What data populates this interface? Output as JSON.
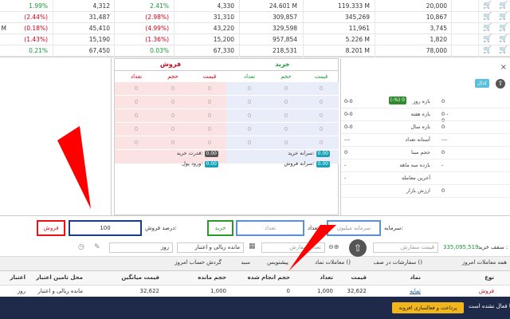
{
  "market": {
    "rows": [
      {
        "c1": "1.99%",
        "c2": "4,312",
        "c3": "2.41%",
        "c4": "4,330",
        "c5": "24.601 M",
        "c6": "119.333 M",
        "c7": "20,000",
        "t1": "pos",
        "t3": "pos"
      },
      {
        "c1": "(2.44%)",
        "c2": "31,487",
        "c3": "(2.98%)",
        "c4": "31,310",
        "c5": "309,857",
        "c6": "345,269",
        "c7": "10,867",
        "t1": "neg",
        "t3": "neg"
      },
      {
        "c1": "(0.18%)",
        "c2": "45,410",
        "c3": "(4.99%)",
        "c4": "43,220",
        "c5": "329,598",
        "c6": "11,961",
        "c7": "3,745",
        "t1": "neg",
        "t3": "neg",
        "lead": "M"
      },
      {
        "c1": "(1.43%)",
        "c2": "15,190",
        "c3": "(1.36%)",
        "c4": "15,200",
        "c5": "957,854",
        "c6": "5.226 M",
        "c7": "1,820",
        "t1": "neg",
        "t3": "neg"
      },
      {
        "c1": "0.21%",
        "c2": "67,450",
        "c3": "0.03%",
        "c4": "67,330",
        "c5": "218,531",
        "c6": "8.201 M",
        "c7": "78,000",
        "t1": "pos",
        "t3": "pos"
      }
    ],
    "cart_icon": "cart-icon"
  },
  "depth": {
    "sell_title": "فروش",
    "buy_title": "خرید",
    "sell_cols": [
      "قیمت",
      "حجم",
      "تعداد"
    ],
    "buy_cols": [
      "قیمت",
      "حجم",
      "تعداد"
    ],
    "zero": "0",
    "buy_power_label": "قدرت خرید:",
    "buy_power_value": "0.00",
    "money_in_label": "ورود پول:",
    "money_in_value": "0.00",
    "buy_capita_label": "سرانه خرید:",
    "buy_capita_value": "0.00",
    "sell_capita_label": "سرانه فروش:",
    "sell_capita_value": "0.00"
  },
  "info": {
    "close_icon": "×",
    "codal_badge": "کدال",
    "rows": [
      {
        "label": "بازه روز",
        "value": "0"
      },
      {
        "label": "بازه هفته",
        "value": "0 - 0"
      },
      {
        "label": "بازه سال",
        "value": "0"
      },
      {
        "label": "آستانه تعداد",
        "value": "---"
      },
      {
        "label": "حجم مبنا",
        "value": "0"
      },
      {
        "label": "بازده سه ماهه",
        "value": "-"
      },
      {
        "label": "آخرین معامله",
        "value": ""
      },
      {
        "label": "ارزش بازار",
        "value": "0"
      }
    ],
    "left_values": [
      "0-0",
      "0-0",
      "0-0",
      "---",
      "0",
      "-",
      "-"
    ],
    "day_badge": "(-%) 0"
  },
  "form": {
    "sell_button": "فروش",
    "sell_percent_value": "100",
    "sell_percent_label": "درصد فروش:",
    "buy_button": "خرید",
    "count_placeholder": "تعداد",
    "count_label": "تعداد:",
    "capital_placeholder": "سرمایه میلیون",
    "capital_label": "سرمایه:",
    "order_price_placeholder": "قیمت سفارش",
    "order_count_placeholder": "تعداد سفارش",
    "credit_select": "مانده ریالی و اعتبار",
    "day_select": "روز",
    "buy_ceiling_label": "سقف خرید :",
    "buy_ceiling_value": "335,095,519"
  },
  "tabs": [
    "همه معاملات امروز",
    "سفارشات در صف ()",
    "معاملات نماد ()",
    "پیشنویس",
    "سبد",
    "گردش حساب امروز"
  ],
  "grid": {
    "headers": [
      "نوع",
      "نماد",
      "قیمت",
      "تعداد",
      "حجم انجام شده",
      "حجم مانده",
      "قیمت میانگین",
      "محل تامین اعتبار",
      "اعتبار"
    ],
    "row": {
      "type": "فروش",
      "symbol": "ثمایه",
      "price": "32,622",
      "count": "1,000",
      "done": "0",
      "remain": "1,000",
      "avg": "32,622",
      "source": "مانده ریالی و اعتبار",
      "credit": "روز"
    }
  },
  "footer": {
    "not_active": "شما فعال نشده است.",
    "pay_button": "پرداخت و فعالسازی افزونه"
  }
}
